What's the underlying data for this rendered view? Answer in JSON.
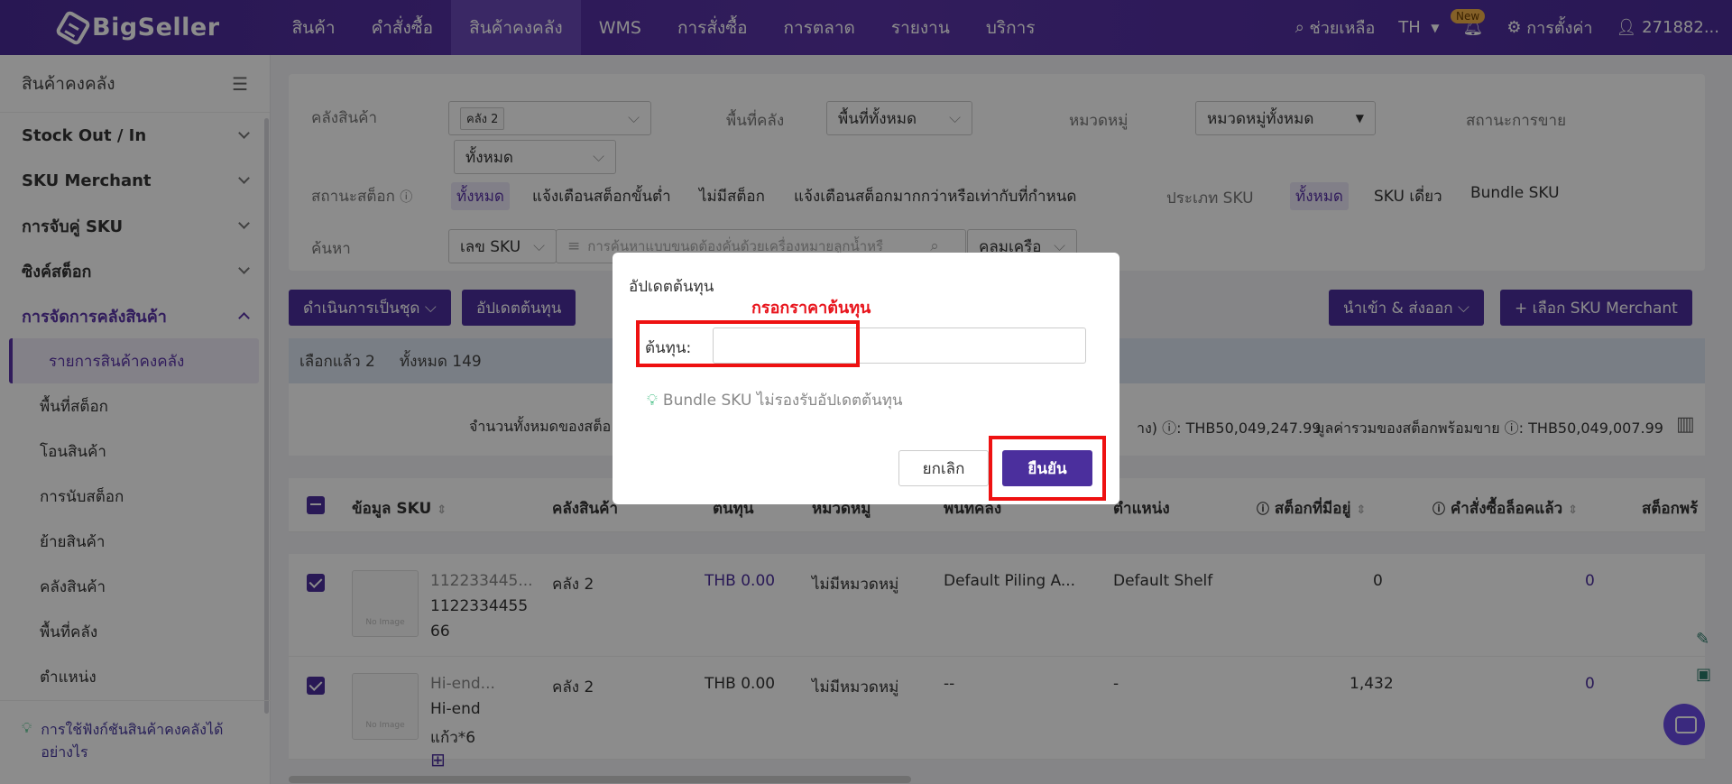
{
  "app": {
    "logo": "BigSeller"
  },
  "topnav": {
    "items": [
      "สินค้า",
      "คำสั่งซื้อ",
      "สินค้าคงคลัง",
      "WMS",
      "การสั่งซื้อ",
      "การตลาด",
      "รายงาน",
      "บริการ"
    ],
    "active_index": 2
  },
  "topright": {
    "help": "ช่วยเหลือ",
    "lang": "TH",
    "new_badge": "New",
    "settings": "การตั้งค่า",
    "user": "271882..."
  },
  "sidebar": {
    "title": "สินค้าคงคลัง",
    "groups": [
      "Stock Out / In",
      "SKU Merchant",
      "การจับคู่ SKU",
      "ซิงค์สต็อก",
      "การจัดการคลังสินค้า"
    ],
    "subitems": [
      "รายการสินค้าคงคลัง",
      "พื้นที่สต็อก",
      "โอนสินค้า",
      "การนับสต็อก",
      "ย้ายสินค้า",
      "คลังสินค้า",
      "พื้นที่คลัง",
      "ตำแหน่ง"
    ],
    "tip": "การใช้ฟังก์ชันสินค้าคงคลังได้อย่างไร"
  },
  "filters": {
    "warehouse_label": "คลังสินค้า",
    "warehouse_tag": "คลัง 2",
    "area_label": "พื้นที่คลัง",
    "area_value": "พื้นที่ทั้งหมด",
    "category_label": "หมวดหมู่",
    "category_value": "หมวดหมู่ทั้งหมด",
    "sale_status_label": "สถานะการขาย",
    "sale_status_value": "ทั้งหมด",
    "stock_status_label": "สถานะสต็อก",
    "stock_options": [
      "ทั้งหมด",
      "แจ้งเตือนสต็อกขั้นต่ำ",
      "ไม่มีสต็อก",
      "แจ้งเตือนสต็อกมากกว่าหรือเท่ากับที่กำหนด"
    ],
    "sku_type_label": "ประเภท SKU",
    "sku_type_options": [
      "ทั้งหมด",
      "SKU เดี่ยว",
      "Bundle SKU"
    ],
    "search_label": "ค้นหา",
    "search_type": "เลข SKU",
    "search_placeholder": "การค้นหาแบบขนดต้องคั่นด้วยเครื่องหมายลูกน้ำหรื",
    "search_tool": "คลุมเครือ"
  },
  "toolbar": {
    "bulk_action": "ดำเนินการเป็นชุด",
    "update_cost": "อัปเดตต้นทุน",
    "import_export": "นำเข้า & ส่งออก",
    "select_sku": "+ เลือก SKU Merchant"
  },
  "selection": {
    "selected": "เลือกแล้ว 2",
    "total": "ทั้งหมด 149"
  },
  "summary": {
    "total_label": "จำนวนทั้งหมดของสต็อ",
    "value1": "าง) ⓘ: THB50,049,247.99",
    "value2": "มูลค่ารวมของสต็อกพร้อมขาย ⓘ: THB50,049,007.99"
  },
  "table": {
    "headers": [
      "ข้อมูล SKU",
      "คลังสินค้า",
      "ต้นทุน",
      "หมวดหมู่",
      "พื้นที่คลัง",
      "ตำแหน่ง",
      "สต็อกที่มีอยู่",
      "คำสั่งซื้อล็อคแล้ว",
      "สต็อกพร้"
    ],
    "rows": [
      {
        "sku_short": "112233445...",
        "sku_full": "1122334455",
        "sku_extra": "66",
        "warehouse": "คลัง 2",
        "cost": "THB 0.00",
        "category": "ไม่มีหมวดหมู่",
        "area": "Default Piling A...",
        "location": "Default Shelf",
        "stock": "0",
        "locked": "0"
      },
      {
        "sku_short": "Hi-end...",
        "sku_full": "Hi-end",
        "sku_extra": "แก้ว*6",
        "warehouse": "คลัง 2",
        "cost": "THB 0.00",
        "category": "ไม่มีหมวดหมู่",
        "area": "--",
        "location": "-",
        "stock": "1,432",
        "locked": "0"
      }
    ]
  },
  "dialog": {
    "title": "อัปเดตต้นทุน",
    "annotation": "กรอกราคาต้นทุน",
    "cost_label": "ต้นทุน:",
    "cost_value": "",
    "hint": "Bundle SKU ไม่รองรับอัปเดตต้นทุน",
    "cancel": "ยกเลิก",
    "confirm": "ยืนยัน"
  },
  "colors": {
    "brand": "#4b2f9d",
    "annotation": "#e8141c"
  }
}
